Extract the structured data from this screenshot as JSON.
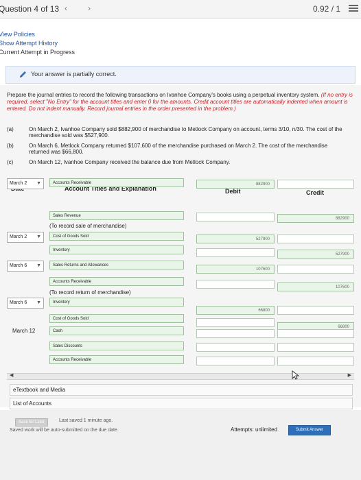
{
  "header": {
    "question_label": "Question 4 of 13",
    "prev_icon": "chevron-left-icon",
    "next_icon": "chevron-right-icon",
    "score": "0.92 / 1",
    "menu_icon": "menu-icon"
  },
  "links": {
    "view_policies": "View Policies",
    "show_attempt_history": "Show Attempt History",
    "current_attempt": "Current Attempt in Progress"
  },
  "status": {
    "icon": "pencil-icon",
    "message": "Your answer is partially correct."
  },
  "problem": {
    "instructions": "Prepare the journal entries to record the following transactions on Ivanhoe Company's books using a perpetual inventory system.",
    "note_red": "(If no entry is required, select \"No Entry\" for the account titles and enter 0 for the amounts. Credit account titles are automatically indented when amount is entered. Do not indent manually. Record journal entries in the order presented in the problem.)",
    "transactions": [
      {
        "label": "(a)",
        "text": "On March 2, Ivanhoe Company sold $882,900 of merchandise to Metlock Company on account, terms 3/10, n/30. The cost of the merchandise sold was $527,900."
      },
      {
        "label": "(b)",
        "text": "On March 6, Metlock Company returned $107,600 of the merchandise purchased on March 2. The cost of the merchandise returned was $66,800."
      },
      {
        "label": "(c)",
        "text": "On March 12, Ivanhoe Company received the balance due from Metlock Company."
      }
    ]
  },
  "table": {
    "headers": {
      "date": "Date",
      "account": "Account Titles and Explanation",
      "debit": "Debit",
      "credit": "Credit"
    },
    "rows": [
      {
        "date": "March 2",
        "date_type": "select",
        "account": "Accounts Receivable",
        "debit": "882900",
        "credit": ""
      },
      {
        "date": "",
        "account": "Sales Revenue",
        "debit": "",
        "credit": "882900"
      },
      {
        "note": "(To record sale of merchandise)"
      },
      {
        "date": "March 2",
        "date_type": "select",
        "account": "Cost of Goods Sold",
        "debit": "527900",
        "credit": ""
      },
      {
        "date": "",
        "account": "Inventory",
        "debit": "",
        "credit": "527900"
      },
      {
        "date": "March 6",
        "date_type": "select",
        "account": "Sales Returns and Allowances",
        "debit": "107600",
        "credit": ""
      },
      {
        "date": "",
        "account": "Accounts Receivable",
        "debit": "",
        "credit": "107600"
      },
      {
        "note": "(To record return of merchandise)"
      },
      {
        "date": "March 6",
        "date_type": "select",
        "account": "Inventory",
        "debit": "66800",
        "credit": ""
      },
      {
        "date": "",
        "account": "Cost of Goods Sold",
        "debit": "",
        "credit": "66800"
      },
      {
        "date": "March 12",
        "date_type": "static",
        "account": "Cash",
        "debit": "",
        "credit": ""
      },
      {
        "date": "",
        "account": "Sales Discounts",
        "debit": "",
        "credit": ""
      },
      {
        "date": "",
        "account": "Accounts Receivable",
        "debit": "",
        "credit": ""
      }
    ]
  },
  "resources": {
    "etextbook": "eTextbook and Media",
    "list_of_accounts": "List of Accounts"
  },
  "footer": {
    "save_for_later": "Save for Later",
    "last_saved": "Last saved 1 minute ago.",
    "auto_submit": "Saved work will be auto-submitted on the due date.",
    "attempts": "Attempts: unlimited",
    "submit": "Submit Answer"
  }
}
